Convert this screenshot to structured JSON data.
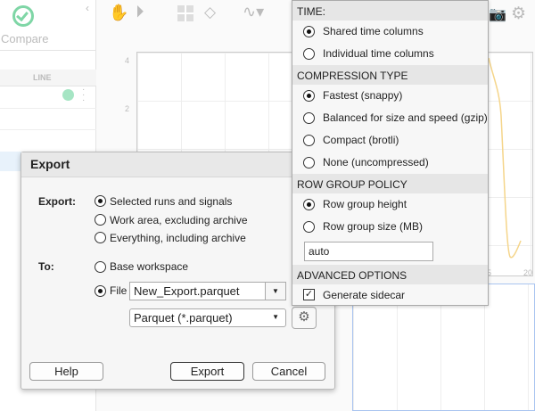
{
  "background": {
    "compare_label": "Compare",
    "column_header": "LINE",
    "axis_ticks_y": [
      "4",
      "2"
    ],
    "axis_ticks_x": [
      "5",
      "20"
    ],
    "accent": "#7fd6a6",
    "curve_color": "#f5d58a"
  },
  "dialog": {
    "title": "Export",
    "export_label": "Export:",
    "export_options": [
      "Selected runs and signals",
      "Work area, excluding archive",
      "Everything, including archive"
    ],
    "export_selected": 0,
    "to_label": "To:",
    "to_options": [
      "Base workspace",
      "File"
    ],
    "to_selected": 1,
    "file_name": "New_Export.parquet",
    "file_type": "Parquet (*.parquet)",
    "buttons": {
      "help": "Help",
      "export": "Export",
      "cancel": "Cancel"
    }
  },
  "options_popup": {
    "time": {
      "header": "TIME:",
      "options": [
        "Shared time columns",
        "Individual time columns"
      ],
      "selected": 0
    },
    "compression": {
      "header": "COMPRESSION TYPE",
      "options": [
        "Fastest (snappy)",
        "Balanced for size and speed (gzip)",
        "Compact (brotli)",
        "None (uncompressed)"
      ],
      "selected": 0
    },
    "row_group": {
      "header": "ROW GROUP POLICY",
      "options": [
        "Row group height",
        "Row group size (MB)"
      ],
      "selected": 0,
      "value": "auto"
    },
    "advanced": {
      "header": "ADVANCED OPTIONS",
      "generate_sidecar_label": "Generate sidecar",
      "generate_sidecar": true
    }
  }
}
